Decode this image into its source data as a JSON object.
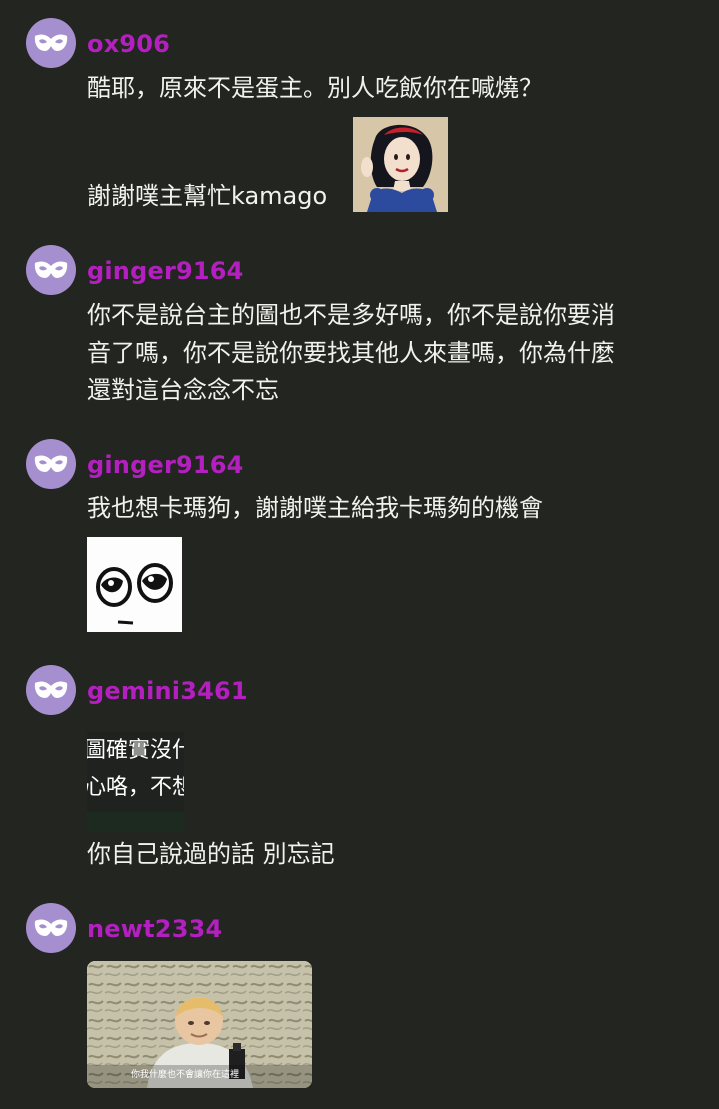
{
  "comments": [
    {
      "username": "ox906",
      "line1": "酷耶，原來不是蛋主。別人吃飯你在喊燒？",
      "line2": "謝謝噗主幫忙kamago"
    },
    {
      "username": "ginger9164",
      "lines": [
        "你不是說台主的圖也不是多好嗎，你不是說你要消",
        "音了嗎，你不是說你要找其他人來畫嗎，你為什麼",
        "還對這台念念不忘"
      ]
    },
    {
      "username": "ginger9164",
      "line1": "我也想卡瑪狗，謝謝噗主給我卡瑪夠的機會"
    },
    {
      "username": "gemini3461",
      "screenshot_lines": [
        "圖確實沒什",
        "心咯，不想"
      ],
      "line1": "你自己說過的話 別忘記"
    },
    {
      "username": "newt2334",
      "video_caption": "你我什麼也不會讓你在這裡"
    }
  ],
  "colors": {
    "background": "#232520",
    "username": "#b41fc0",
    "avatar": "#a58fce",
    "text": "#f1f1ee"
  },
  "icons": {
    "avatar": "mask-icon",
    "sticker_1": "snow-white-sticker",
    "sticker_2": "eyes-sticker"
  }
}
